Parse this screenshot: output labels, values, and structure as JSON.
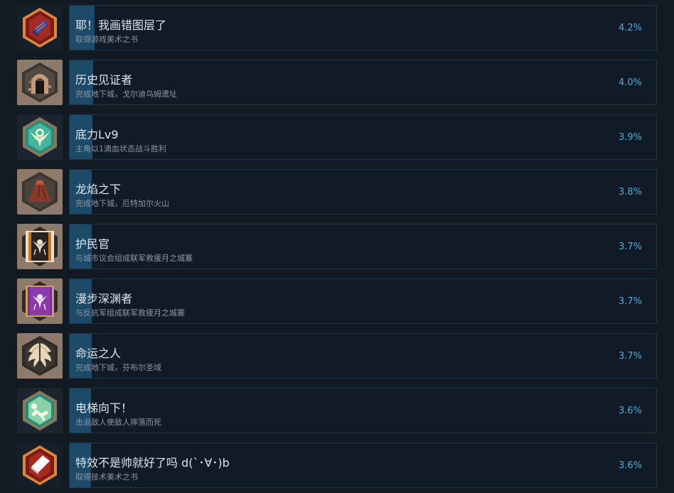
{
  "achievements": [
    {
      "title": "耶！我画错图层了",
      "description": "取得游戏美术之书",
      "percent_text": "4.2%",
      "percent": 4.2,
      "icon": "red-art-book-icon"
    },
    {
      "title": "历史见证者",
      "description": "完成地下城，戈尔迪乌姆遗址",
      "percent_text": "4.0%",
      "percent": 4.0,
      "icon": "stone-archway-icon"
    },
    {
      "title": "底力Lv9",
      "description": "主角以1滴血状态战斗胜利",
      "percent_text": "3.9%",
      "percent": 3.9,
      "icon": "green-winged-emblem-icon"
    },
    {
      "title": "龙焰之下",
      "description": "完成地下城，厄特加尔火山",
      "percent_text": "3.8%",
      "percent": 3.8,
      "icon": "volcano-icon"
    },
    {
      "title": "护民官",
      "description": "与城市议会组成联军救援月之城塞",
      "percent_text": "3.7%",
      "percent": 3.7,
      "icon": "orange-crest-icon"
    },
    {
      "title": "漫步深渊者",
      "description": "与反抗军组成联军救援月之城塞",
      "percent_text": "3.7%",
      "percent": 3.7,
      "icon": "purple-crest-icon"
    },
    {
      "title": "命运之人",
      "description": "完成地下城，芬布尔圣域",
      "percent_text": "3.7%",
      "percent": 3.7,
      "icon": "angel-wings-icon"
    },
    {
      "title": "电梯向下！",
      "description": "击退敌人使敌人摔落而死",
      "percent_text": "3.6%",
      "percent": 3.6,
      "icon": "falling-figure-icon"
    },
    {
      "title": "特效不是帅就好了吗 d(ˋ･∀･)b",
      "description": "取得技术美术之书",
      "percent_text": "3.6%",
      "percent": 3.6,
      "icon": "white-tech-book-icon"
    }
  ]
}
